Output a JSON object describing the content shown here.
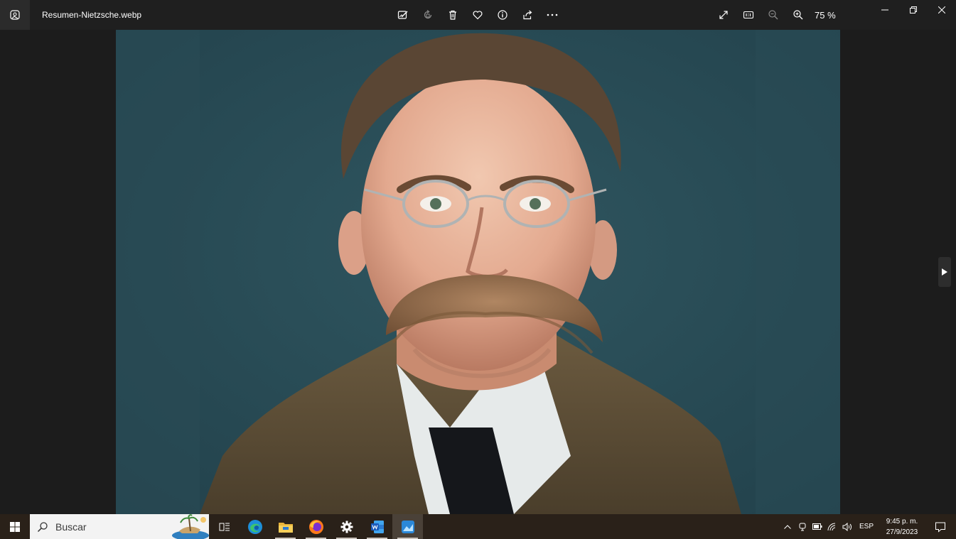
{
  "window": {
    "file_name": "Resumen-Nietzsche.webp",
    "zoom_label": "75 %"
  },
  "toolbar": {
    "icons": [
      "edit-image-icon",
      "rotate-icon",
      "delete-icon",
      "favorite-icon",
      "info-icon",
      "share-icon",
      "more-icon"
    ],
    "right_icons": [
      "fullscreen-icon",
      "actual-size-icon",
      "zoom-out-icon",
      "zoom-in-icon"
    ]
  },
  "window_controls": [
    "minimize-icon",
    "restore-icon",
    "close-icon"
  ],
  "photo": {
    "subject": "portrait"
  },
  "taskbar": {
    "search_placeholder": "Buscar",
    "apps": [
      "task-view-icon",
      "edge-icon",
      "file-explorer-icon",
      "firefox-icon",
      "settings-icon",
      "word-icon",
      "photos-icon"
    ],
    "tray": {
      "language": "ESP",
      "time": "9:45 p. m.",
      "date": "27/9/2023"
    }
  },
  "colors": {
    "titlebar": "#1f1f1f",
    "taskbar": "#2a2119",
    "photo_background": "#2b4d57"
  }
}
